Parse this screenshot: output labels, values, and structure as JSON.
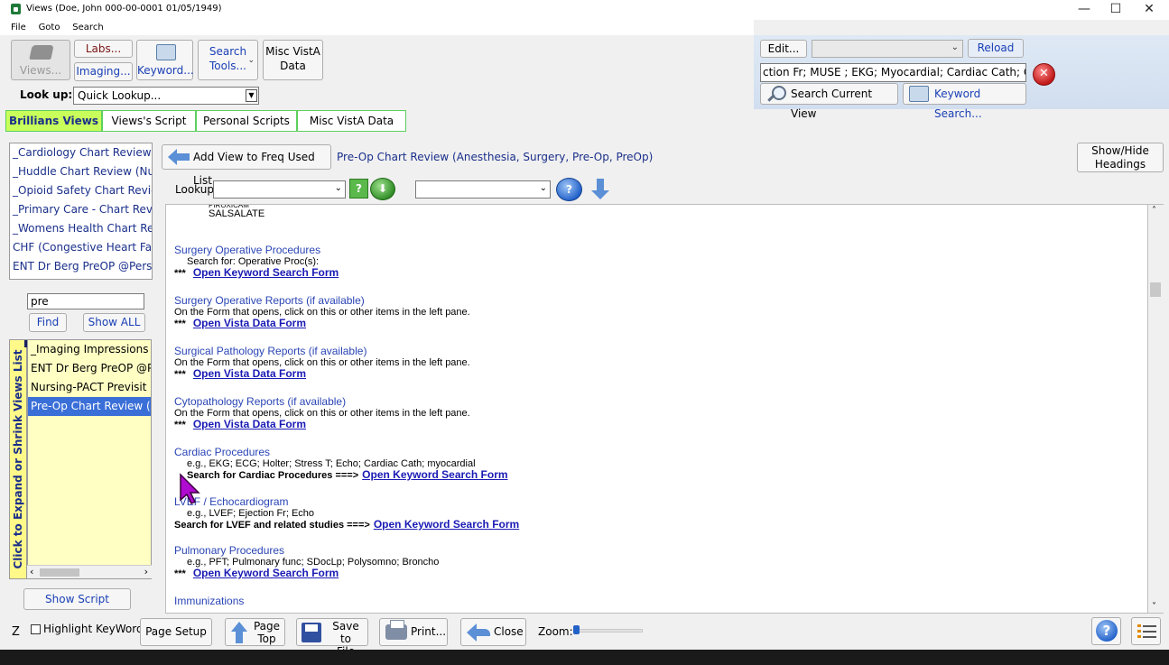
{
  "window": {
    "title": "Views (Doe, John  000-00-0001  01/05/1949)",
    "minimize": "—",
    "maximize": "☐",
    "close": "✕"
  },
  "menu": [
    "File",
    "Goto",
    "Search"
  ],
  "toolbar": {
    "views": "Views...",
    "labs": "Labs...",
    "imaging": "Imaging...",
    "keyword": "Keyword...",
    "search_tools_1": "Search",
    "search_tools_2": "Tools...",
    "misc_1": "Misc VistA",
    "misc_2": "Data",
    "lookup_label": "Look up:",
    "lookup_value": "Quick Lookup..."
  },
  "right_panel": {
    "edit": "Edit...",
    "reload": "Reload",
    "keyword_text": "ction Fr; MUSE ; EKG; Myocardial; Cardiac Cath; CABG",
    "search_current_view": "Search Current View",
    "keyword_search": "Keyword Search..."
  },
  "tabs": [
    "Brillians Views",
    "Views's Script",
    "Personal Scripts",
    "Misc VistA Data"
  ],
  "left_list": [
    "_Cardiology Chart Review",
    "_Huddle Chart Review (Nursi",
    "_Opioid Safety Chart Review",
    "_Primary Care - Chart Review",
    "_Womens Health Chart Revie",
    "CHF (Congestive Heart Fail C",
    "ENT Dr Berg PreOP @Persor"
  ],
  "filter": {
    "value": "pre",
    "find": "Find",
    "show_all": "Show ALL"
  },
  "views_list_tab": "Click to Expand or Shrink Views List",
  "fav_list": [
    "_Imaging Impressions",
    "ENT Dr Berg PreOP @Pe",
    "Nursing-PACT Previsit Ch",
    "Pre-Op Chart Review (An"
  ],
  "show_script": "Show Script",
  "view": {
    "add_button": "Add View to Freq Used List",
    "title": "Pre-Op Chart Review (Anesthesia, Surgery, Pre-Op, PreOp)",
    "show_hide_1": "Show/Hide",
    "show_hide_2": "Headings",
    "lookup_label": "Lookup:",
    "qmark": "?"
  },
  "content": {
    "cut_line": "PIROXICAM",
    "salsalate": "SALSALATE",
    "stars": "***",
    "s1_h": "Surgery Operative Procedures",
    "s1_l": "Search for: Operative Proc(s):",
    "link_keyword": "Open Keyword Search Form",
    "link_vista": "Open Vista Data Form",
    "s2_h": "Surgery Operative Reports (if available)",
    "form_note": "On the Form that opens, click on this or other items in the left pane.",
    "s3_h": "Surgical Pathology Reports (if available)",
    "s4_h": "Cytopathology Reports (if available)",
    "s5_h": "Cardiac Procedures",
    "s5_l": "e.g., EKG; ECG; Holter; Stress T; Echo; Cardiac Cath; myocardial",
    "s5_b": "Search for Cardiac Procedures ===>",
    "s6_h": "LVEF / Echocardiogram",
    "s6_l": "e.g., LVEF; Ejection Fr; Echo",
    "s6_b": "Search for LVEF and related studies ===>",
    "s7_h": "Pulmonary Procedures",
    "s7_l": "e.g., PFT; Pulmonary func; SDocLp; Polysomno; Broncho",
    "s8_h": "Immunizations"
  },
  "bottom": {
    "z": "Z",
    "highlight": "Highlight KeyWords",
    "page_setup": "Page Setup",
    "page_top_1": "Page",
    "page_top_2": "Top",
    "save_1": "Save to",
    "save_2": "File",
    "print": "Print...",
    "close": "Close",
    "zoom": "Zoom:"
  }
}
